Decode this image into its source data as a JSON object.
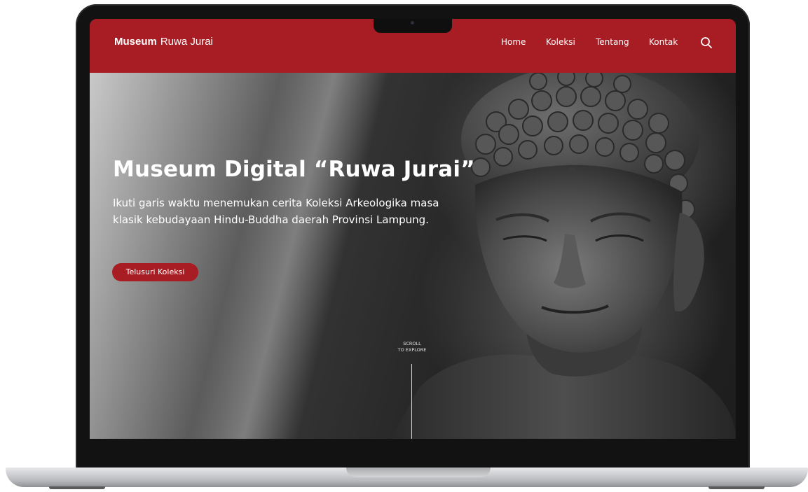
{
  "header": {
    "brand_strong": "Museum",
    "brand_rest": "Ruwa Jurai",
    "nav": [
      {
        "label": "Home"
      },
      {
        "label": "Koleksi"
      },
      {
        "label": "Tentang"
      },
      {
        "label": "Kontak"
      }
    ],
    "search_icon": "search-icon"
  },
  "hero": {
    "title": "Museum Digital “Ruwa Jurai”",
    "subtitle": "Ikuti garis waktu menemukan cerita Koleksi Arkeologika masa klasik kebudayaan Hindu-Buddha daerah Provinsi Lampung.",
    "cta_label": "Telusuri Koleksi",
    "scroll_line1": "SCROLL",
    "scroll_line2": "TO EXPLORE"
  },
  "colors": {
    "brand_red": "#a81d23",
    "text": "#ffffff",
    "hero_dark": "#1e1e1e"
  }
}
